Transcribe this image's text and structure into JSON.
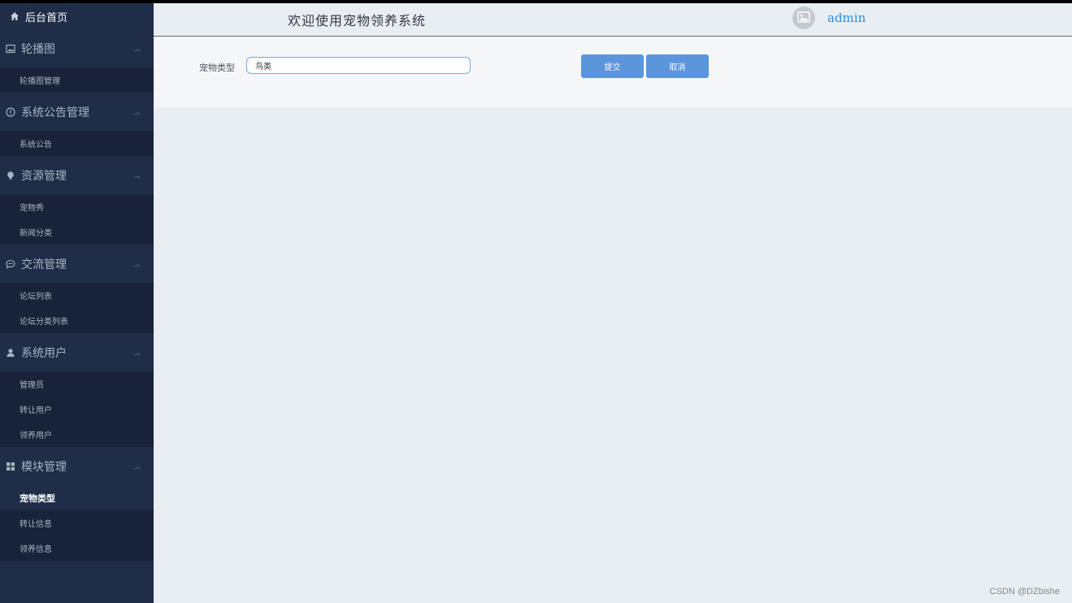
{
  "sidebar": {
    "home": {
      "label": "后台首页",
      "icon": "home-icon"
    },
    "groups": [
      {
        "title": "轮播图",
        "icon": "image-icon",
        "items": [
          "轮播图管理"
        ]
      },
      {
        "title": "系统公告管理",
        "icon": "info-icon",
        "items": [
          "系统公告"
        ]
      },
      {
        "title": "资源管理",
        "icon": "bulb-icon",
        "items": [
          "宠物秀",
          "新闻分类"
        ]
      },
      {
        "title": "交流管理",
        "icon": "chat-icon",
        "items": [
          "论坛列表",
          "论坛分类列表"
        ]
      },
      {
        "title": "系统用户",
        "icon": "user-icon",
        "items": [
          "管理员",
          "转让用户",
          "领养用户"
        ]
      },
      {
        "title": "模块管理",
        "icon": "grid-icon",
        "items": [
          "宠物类型",
          "转让信息",
          "领养信息"
        ]
      }
    ],
    "active_item": "宠物类型"
  },
  "header": {
    "title": "欢迎使用宠物领养系统",
    "username": "admin"
  },
  "form": {
    "label": "宠物类型",
    "value": "鸟类",
    "submit_label": "提交",
    "cancel_label": "取消"
  },
  "watermark": "CSDN @DZbishe"
}
